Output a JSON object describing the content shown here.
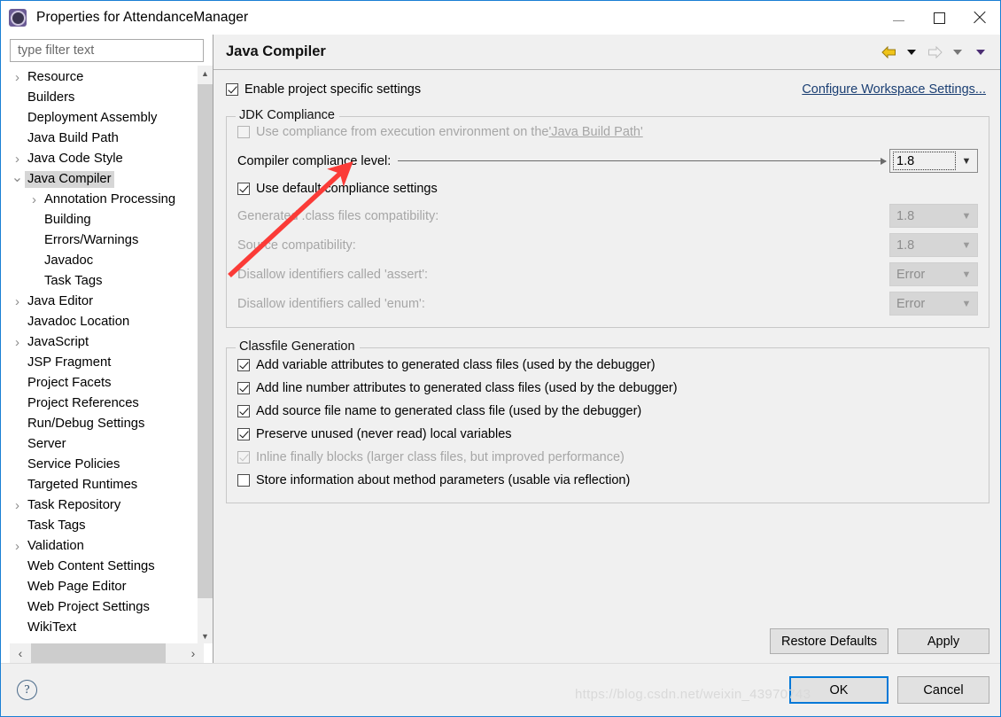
{
  "window": {
    "title": "Properties for AttendanceManager",
    "app_icon": "properties-gear-icon",
    "minimize_label": "Minimize",
    "maximize_label": "Maximize",
    "close_label": "Close"
  },
  "sidebar": {
    "filter": {
      "placeholder": "type filter text",
      "value": ""
    },
    "items": [
      {
        "label": "Resource",
        "indent": 0,
        "twisty": "collapsed",
        "selected": false
      },
      {
        "label": "Builders",
        "indent": 0,
        "twisty": "none",
        "selected": false
      },
      {
        "label": "Deployment Assembly",
        "indent": 0,
        "twisty": "none",
        "selected": false
      },
      {
        "label": "Java Build Path",
        "indent": 0,
        "twisty": "none",
        "selected": false
      },
      {
        "label": "Java Code Style",
        "indent": 0,
        "twisty": "collapsed",
        "selected": false
      },
      {
        "label": "Java Compiler",
        "indent": 0,
        "twisty": "expanded",
        "selected": true
      },
      {
        "label": "Annotation Processing",
        "indent": 1,
        "twisty": "collapsed",
        "selected": false
      },
      {
        "label": "Building",
        "indent": 1,
        "twisty": "none",
        "selected": false
      },
      {
        "label": "Errors/Warnings",
        "indent": 1,
        "twisty": "none",
        "selected": false
      },
      {
        "label": "Javadoc",
        "indent": 1,
        "twisty": "none",
        "selected": false
      },
      {
        "label": "Task Tags",
        "indent": 1,
        "twisty": "none",
        "selected": false
      },
      {
        "label": "Java Editor",
        "indent": 0,
        "twisty": "collapsed",
        "selected": false
      },
      {
        "label": "Javadoc Location",
        "indent": 0,
        "twisty": "none",
        "selected": false
      },
      {
        "label": "JavaScript",
        "indent": 0,
        "twisty": "collapsed",
        "selected": false
      },
      {
        "label": "JSP Fragment",
        "indent": 0,
        "twisty": "none",
        "selected": false
      },
      {
        "label": "Project Facets",
        "indent": 0,
        "twisty": "none",
        "selected": false
      },
      {
        "label": "Project References",
        "indent": 0,
        "twisty": "none",
        "selected": false
      },
      {
        "label": "Run/Debug Settings",
        "indent": 0,
        "twisty": "none",
        "selected": false
      },
      {
        "label": "Server",
        "indent": 0,
        "twisty": "none",
        "selected": false
      },
      {
        "label": "Service Policies",
        "indent": 0,
        "twisty": "none",
        "selected": false
      },
      {
        "label": "Targeted Runtimes",
        "indent": 0,
        "twisty": "none",
        "selected": false
      },
      {
        "label": "Task Repository",
        "indent": 0,
        "twisty": "collapsed",
        "selected": false
      },
      {
        "label": "Task Tags",
        "indent": 0,
        "twisty": "none",
        "selected": false
      },
      {
        "label": "Validation",
        "indent": 0,
        "twisty": "collapsed",
        "selected": false
      },
      {
        "label": "Web Content Settings",
        "indent": 0,
        "twisty": "none",
        "selected": false
      },
      {
        "label": "Web Page Editor",
        "indent": 0,
        "twisty": "none",
        "selected": false
      },
      {
        "label": "Web Project Settings",
        "indent": 0,
        "twisty": "none",
        "selected": false
      },
      {
        "label": "WikiText",
        "indent": 0,
        "twisty": "none",
        "selected": false
      }
    ]
  },
  "page": {
    "title": "Java Compiler",
    "nav": {
      "back_icon": "back-arrow-icon",
      "back_menu_icon": "chevron-down-icon",
      "forward_icon": "forward-arrow-icon",
      "forward_menu_icon": "chevron-down-icon",
      "history_menu_icon": "chevron-down-icon"
    },
    "enable_project_specific": {
      "label": "Enable project specific settings",
      "checked": true
    },
    "configure_workspace_link": "Configure Workspace Settings...",
    "jdk_compliance": {
      "title": "JDK Compliance",
      "use_execution_env": {
        "label_prefix": "Use compliance from execution environment on the ",
        "link": "'Java Build Path'",
        "checked": false,
        "enabled": false
      },
      "compliance_level": {
        "label": "Compiler compliance level:",
        "value": "1.8",
        "enabled": true,
        "focused": true
      },
      "use_default_compliance": {
        "label": "Use default compliance settings",
        "checked": true
      },
      "rows": [
        {
          "label": "Generated .class files compatibility:",
          "value": "1.8",
          "enabled": false
        },
        {
          "label": "Source compatibility:",
          "value": "1.8",
          "enabled": false
        },
        {
          "label": "Disallow identifiers called 'assert':",
          "value": "Error",
          "enabled": false
        },
        {
          "label": "Disallow identifiers called 'enum':",
          "value": "Error",
          "enabled": false
        }
      ]
    },
    "classfile_generation": {
      "title": "Classfile Generation",
      "options": [
        {
          "label": "Add variable attributes to generated class files (used by the debugger)",
          "checked": true,
          "enabled": true
        },
        {
          "label": "Add line number attributes to generated class files (used by the debugger)",
          "checked": true,
          "enabled": true
        },
        {
          "label": "Add source file name to generated class file (used by the debugger)",
          "checked": true,
          "enabled": true
        },
        {
          "label": "Preserve unused (never read) local variables",
          "checked": true,
          "enabled": true
        },
        {
          "label": "Inline finally blocks (larger class files, but improved performance)",
          "checked": true,
          "enabled": false
        },
        {
          "label": "Store information about method parameters (usable via reflection)",
          "checked": false,
          "enabled": true
        }
      ]
    },
    "restore_defaults_label": "Restore Defaults",
    "apply_label": "Apply"
  },
  "footer": {
    "help_icon": "help-question-icon",
    "ok_label": "OK",
    "cancel_label": "Cancel",
    "watermark": "https://blog.csdn.net/weixin_43970743"
  },
  "annotation": {
    "type": "red-arrow",
    "color": "#fb3b37",
    "points_to": "compliance-level-combo"
  },
  "colors": {
    "accent": "#0078d7",
    "window_border": "#1a7fd4",
    "pane_bg": "#f0f0f0",
    "annotation_red": "#fb3b37",
    "link": "#1b3f73"
  }
}
